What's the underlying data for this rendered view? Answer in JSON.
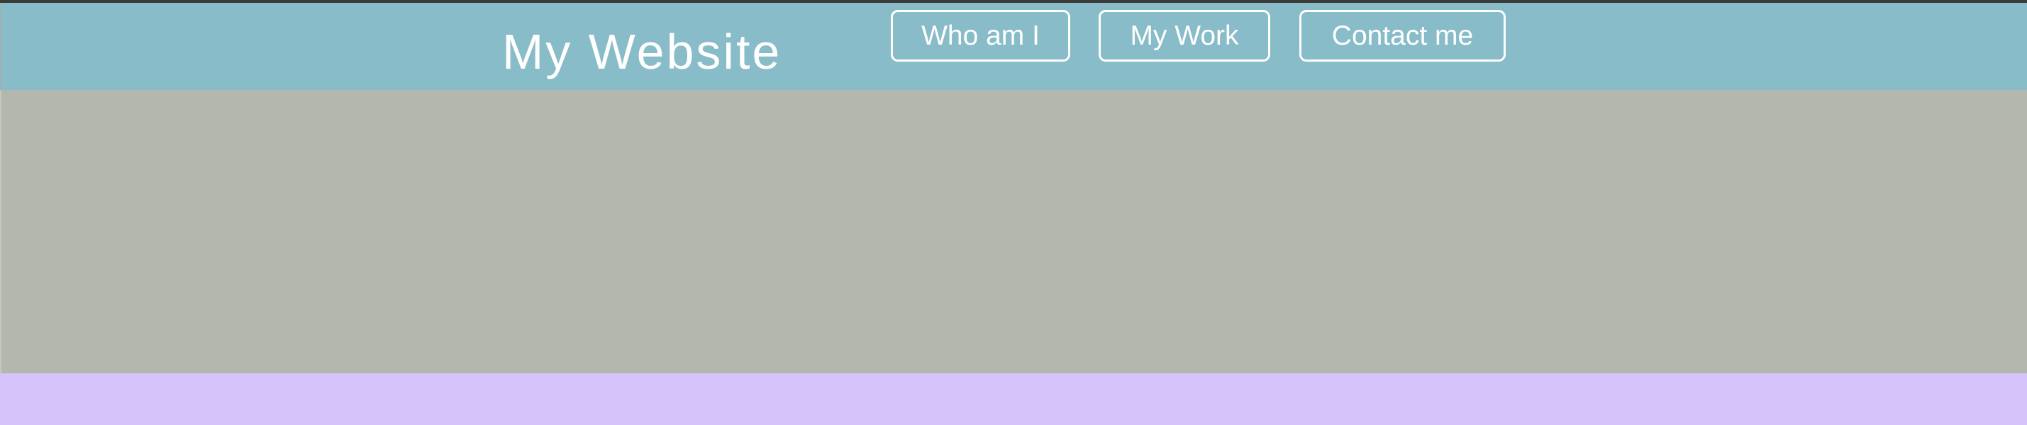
{
  "header": {
    "title": "My Website",
    "nav": [
      {
        "label": "Who am I"
      },
      {
        "label": "My Work"
      },
      {
        "label": "Contact me"
      }
    ]
  },
  "colors": {
    "header_bg": "#88bcc8",
    "hero_bg": "#b3b7ad",
    "footer_bg": "#d5c3f9",
    "text": "#ffffff"
  }
}
